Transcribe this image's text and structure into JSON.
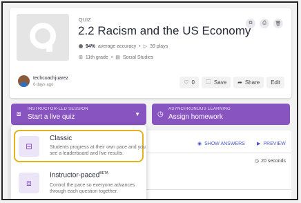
{
  "quiz": {
    "type_label": "QUIZ",
    "title": "2.2 Racism and the US Economy",
    "accuracy": "94%",
    "accuracy_suffix": "average accuracy",
    "plays": "39 plays",
    "grade": "11th grade",
    "subject": "Social Studies"
  },
  "author": {
    "name": "techcoachjuarez",
    "time": "6 days ago"
  },
  "actions": {
    "likes": "0",
    "save": "Save",
    "share": "Share",
    "edit": "Edit"
  },
  "live": {
    "small": "INSTRUCTOR-LED SESSION",
    "main": "Start a live quiz"
  },
  "homework": {
    "small": "ASYNCHRONOUS LEARNING",
    "main": "Assign homework"
  },
  "toolbar": {
    "show_answers": "SHOW ANSWERS",
    "preview": "PREVIEW",
    "seconds": "20 seconds"
  },
  "dropdown": {
    "classic": {
      "title": "Classic",
      "desc": "Students progress at their own pace and you see a leaderboard and live results."
    },
    "paced": {
      "title": "Instructor-paced",
      "badge": "BETA",
      "desc": "Control the pace so everyone advances through each question together."
    }
  },
  "colors": {
    "accent": "#8854c0",
    "highlight": "#e2b21f",
    "link": "#4a54c9"
  }
}
